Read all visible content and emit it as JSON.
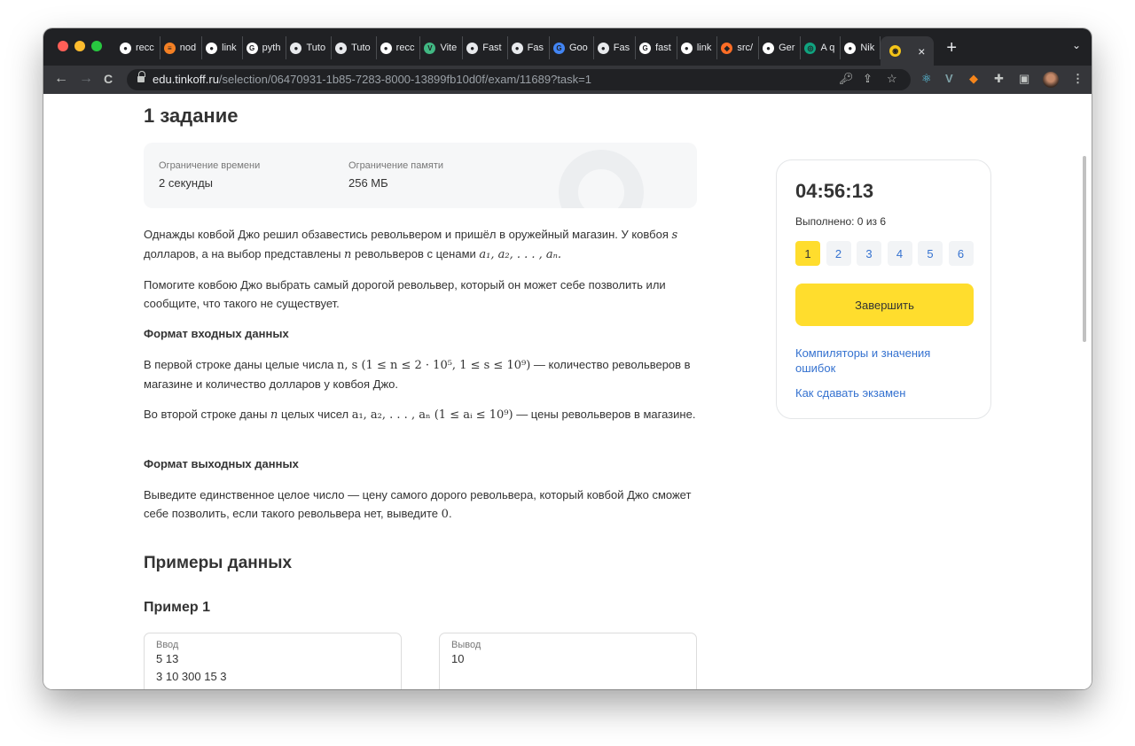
{
  "browser": {
    "tabs": [
      {
        "label": "recc",
        "icon": "github-icon",
        "color": "#ffffff"
      },
      {
        "label": "nod",
        "icon": "stack-icon",
        "color": "#f48024"
      },
      {
        "label": "link",
        "icon": "github-icon",
        "color": "#ffffff"
      },
      {
        "label": "pyth",
        "icon": "google-icon",
        "color": "#ffffff"
      },
      {
        "label": "Tuto",
        "icon": "dark-circle-icon",
        "color": "#e8eaed"
      },
      {
        "label": "Tuto",
        "icon": "dark-circle-icon",
        "color": "#e8eaed"
      },
      {
        "label": "recc",
        "icon": "github-icon",
        "color": "#ffffff"
      },
      {
        "label": "Vite",
        "icon": "vue-icon",
        "color": "#41b883"
      },
      {
        "label": "Fast",
        "icon": "dark-circle-icon",
        "color": "#e8eaed"
      },
      {
        "label": "Fas",
        "icon": "dark-circle-icon",
        "color": "#e8eaed"
      },
      {
        "label": "Goo",
        "icon": "translate-icon",
        "color": "#4285f4"
      },
      {
        "label": "Fas",
        "icon": "dark-circle-icon",
        "color": "#e8eaed"
      },
      {
        "label": "fast",
        "icon": "google-icon",
        "color": "#ffffff"
      },
      {
        "label": "link",
        "icon": "github-icon",
        "color": "#ffffff"
      },
      {
        "label": "src/",
        "icon": "gitlab-icon",
        "color": "#fc6d26"
      },
      {
        "label": "Ger",
        "icon": "github-icon",
        "color": "#ffffff"
      },
      {
        "label": "A q",
        "icon": "openai-icon",
        "color": "#10a37f"
      },
      {
        "label": "Nik",
        "icon": "github-icon",
        "color": "#ffffff"
      }
    ],
    "active_tab_close": "×",
    "new_tab": "+",
    "tab_menu": "⌄",
    "url_host": "edu.tinkoff.ru",
    "url_path": "/selection/06470931-1b85-7283-8000-13899fb10d0f/exam/11689?task=1",
    "nav": {
      "back": "←",
      "forward": "→",
      "reload": "C"
    }
  },
  "task": {
    "title": "1 задание",
    "time_limit_label": "Ограничение времени",
    "time_limit_value": "2 секунды",
    "memory_limit_label": "Ограничение памяти",
    "memory_limit_value": "256 МБ",
    "statement_1a": "Однажды ковбой Джо решил обзавестись револьвером и пришёл в оружейный магазин. У ковбоя ",
    "statement_1_s": "s",
    "statement_1b": "долларов, а на выбор представлены ",
    "statement_1_n": "n",
    "statement_1c": " револьверов с ценами ",
    "statement_1_seq": "a₁, a₂, . . . , aₙ.",
    "statement_2": "Помогите ковбою Джо выбрать самый дорогой револьвер, который он может себе позволить или сообщите, что такого не существует.",
    "input_heading": "Формат входных данных",
    "input_1a": "В первой строке даны целые числа ",
    "input_1_math": "n, s (1 ≤ n ≤ 2 · 10⁵, 1 ≤ s ≤ 10⁹)",
    "input_1b": " — количество револьверов в магазине и количество долларов у ковбоя Джо.",
    "input_2a": "Во второй строке даны ",
    "input_2_n": "n",
    "input_2b": " целых чисел ",
    "input_2_math": "a₁, a₂, . . . , aₙ (1 ≤ aᵢ ≤ 10⁹)",
    "input_2c": " — цены револьверов в магазине.",
    "output_heading": "Формат выходных данных",
    "output_1a": "Выведите единственное целое число — цену самого дорого револьвера, который ковбой Джо сможет себе позволить, если такого револьвера нет, выведите ",
    "output_1_zero": "0",
    "output_1b": "."
  },
  "examples": {
    "heading": "Примеры данных",
    "sample_title": "Пример 1",
    "input_label": "Ввод",
    "input_lines": [
      "5 13",
      "3 10 300 15 3"
    ],
    "output_label": "Вывод",
    "output_lines": [
      "10"
    ]
  },
  "sidebar": {
    "timer": "04:56:13",
    "progress": "Выполнено: 0 из 6",
    "task_numbers": [
      "1",
      "2",
      "3",
      "4",
      "5",
      "6"
    ],
    "active_task": "1",
    "finish_button": "Завершить",
    "link_compilers": "Компиляторы и значения ошибок",
    "link_howto": "Как сдавать экзамен",
    "accent_color": "#ffdd2d",
    "link_color": "#3572d0"
  }
}
